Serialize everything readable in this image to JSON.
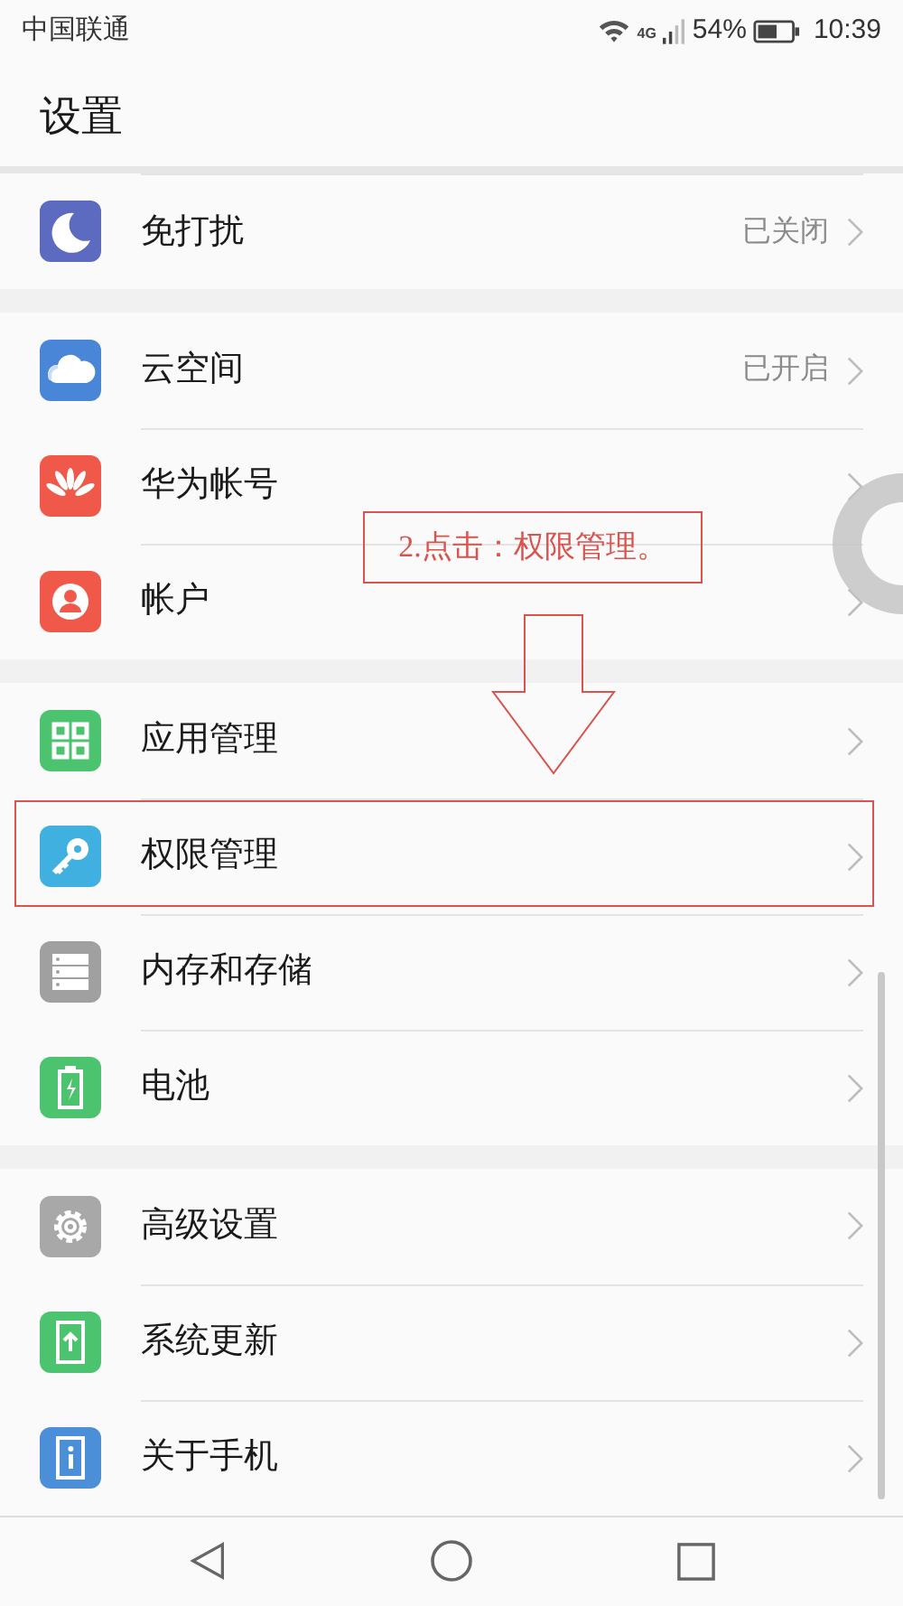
{
  "status_bar": {
    "carrier": "中国联通",
    "network": "4G",
    "battery": "54%",
    "time": "10:39"
  },
  "title": "设置",
  "groups": [
    {
      "items": [
        {
          "label": "免打扰",
          "value": "已关闭",
          "highlighted": false
        }
      ]
    },
    {
      "items": [
        {
          "label": "云空间",
          "value": "已开启",
          "highlighted": false
        },
        {
          "label": "华为帐号",
          "highlighted": false
        },
        {
          "label": "帐户",
          "highlighted": false
        }
      ]
    },
    {
      "items": [
        {
          "label": "应用管理",
          "highlighted": false
        },
        {
          "label": "权限管理",
          "highlighted": true
        },
        {
          "label": "内存和存储",
          "highlighted": false
        },
        {
          "label": "电池",
          "highlighted": false
        }
      ]
    },
    {
      "items": [
        {
          "label": "高级设置",
          "highlighted": false
        },
        {
          "label": "系统更新",
          "highlighted": false
        },
        {
          "label": "关于手机",
          "highlighted": false
        }
      ]
    }
  ],
  "annotation": {
    "text": "2.点击：权限管理。"
  }
}
